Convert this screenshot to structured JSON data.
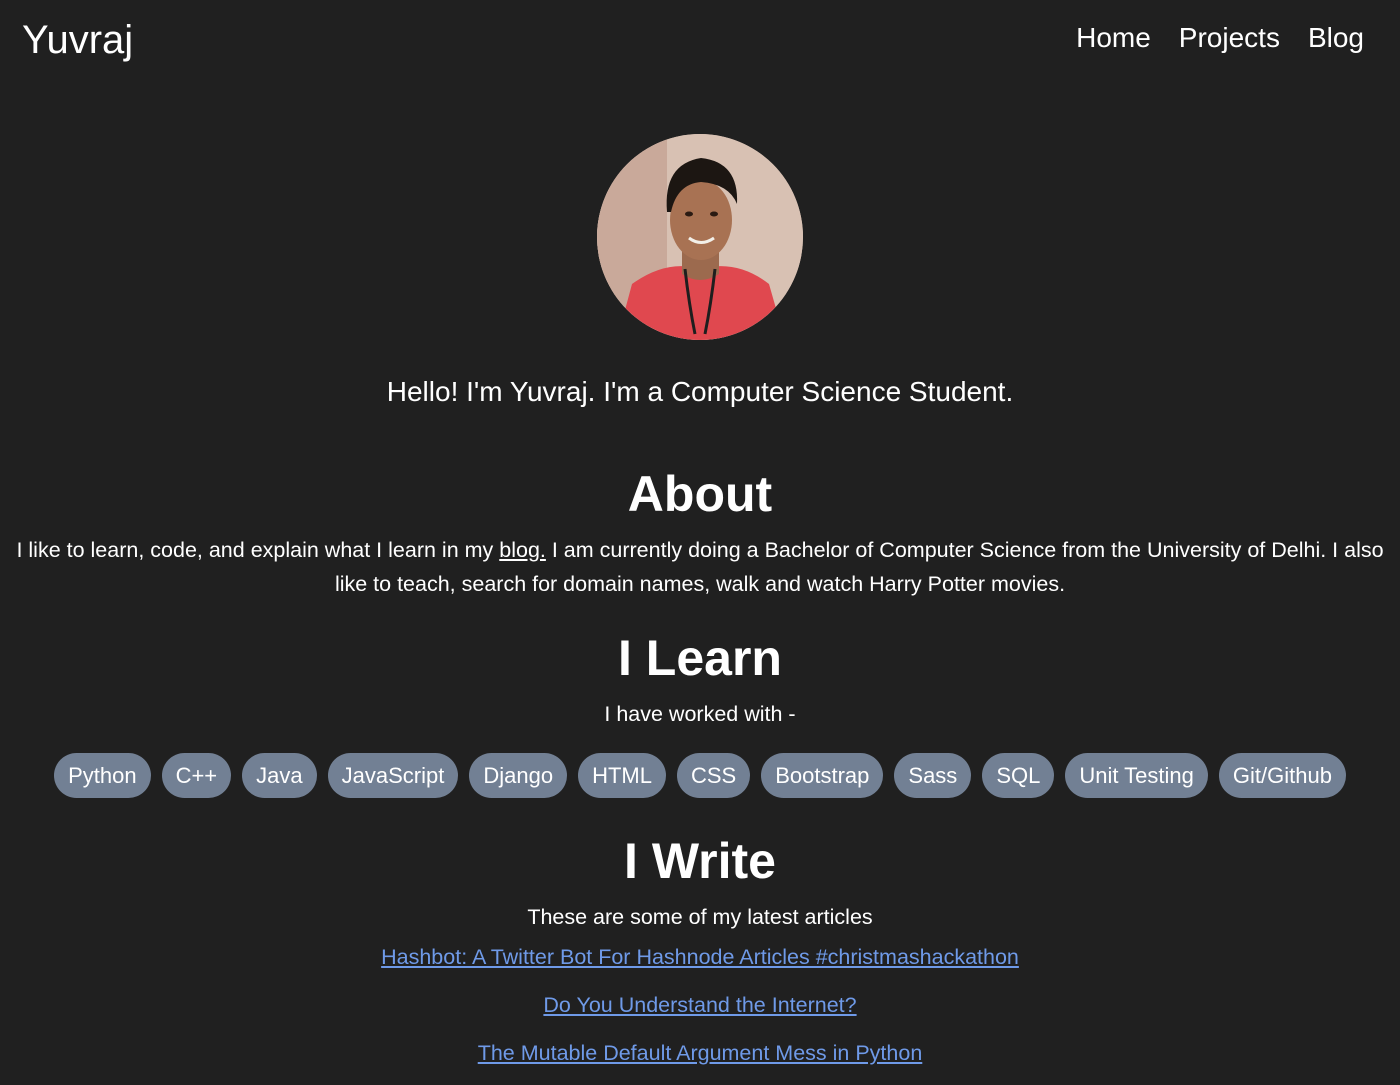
{
  "navbar": {
    "brand": "Yuvraj",
    "links": [
      "Home",
      "Projects",
      "Blog"
    ]
  },
  "profile": {
    "avatar_alt": "profile photo",
    "intro": "Hello! I'm Yuvraj. I'm a Computer Science Student."
  },
  "about": {
    "title": "About",
    "text_before": "I like to learn, code, and explain what I learn in my ",
    "blog_link": "blog.",
    "text_after": " I am currently doing a Bachelor of Computer Science from the University of Delhi. I also like to teach, search for domain names, walk and watch Harry Potter movies."
  },
  "learn": {
    "title": "I Learn",
    "subtitle": "I have worked with -",
    "skills": [
      "Python",
      "C++",
      "Java",
      "JavaScript",
      "Django",
      "HTML",
      "CSS",
      "Bootstrap",
      "Sass",
      "SQL",
      "Unit Testing",
      "Git/Github"
    ]
  },
  "write": {
    "title": "I Write",
    "subtitle": "These are some of my latest articles",
    "articles": [
      "Hashbot: A Twitter Bot For Hashnode Articles #christmashackathon",
      "Do You Understand the Internet?",
      "The Mutable Default Argument Mess in Python"
    ]
  },
  "colors": {
    "background": "#202020",
    "skill_badge": "#728094",
    "link": "#6f9ae8"
  }
}
